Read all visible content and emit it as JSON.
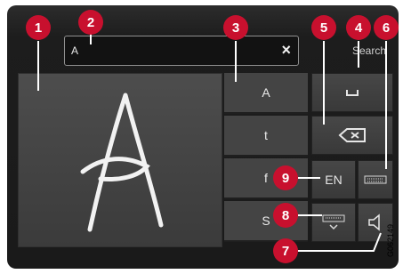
{
  "input": {
    "value": "A",
    "clear_icon": "close-icon"
  },
  "header": {
    "search_label": "Search"
  },
  "candidates": [
    "A",
    "t",
    "f",
    "S"
  ],
  "keys": {
    "space_icon": "space-icon",
    "backspace_icon": "backspace-icon",
    "language": "EN",
    "keyboard_icon": "keyboard-icon",
    "hide_keyboard_icon": "keyboard-hide-icon",
    "sound_icon": "speaker-icon"
  },
  "handwriting": {
    "recognized_letter": "A"
  },
  "callouts": [
    "1",
    "2",
    "3",
    "4",
    "5",
    "6",
    "7",
    "8",
    "9"
  ],
  "image_ref": "G062149",
  "colors": {
    "callout": "#c8102e",
    "panel": "#1a1a1a"
  }
}
